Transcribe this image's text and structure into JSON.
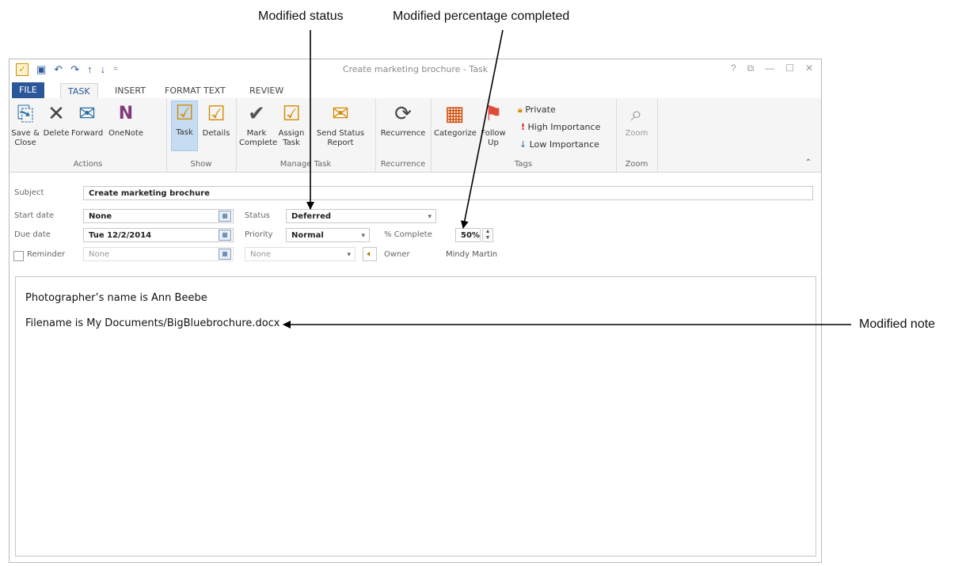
{
  "callouts": {
    "modified_status": "Modified status",
    "modified_percentage": "Modified percentage completed",
    "modified_note": "Modified note"
  },
  "window": {
    "title": "Create marketing brochure - Task",
    "help": "?",
    "restore_ribbon": "⧉",
    "minimize": "—",
    "maximize": "☐",
    "close": "✕"
  },
  "quick_access": {
    "app_icon": "task-app-icon",
    "save": "save-icon",
    "undo": "undo-icon",
    "redo": "redo-icon",
    "up": "arrow-up-icon",
    "down": "arrow-down-icon",
    "customize": "customize-icon"
  },
  "tabs": [
    "FILE",
    "TASK",
    "INSERT",
    "FORMAT TEXT",
    "REVIEW"
  ],
  "ribbon": {
    "groups": {
      "actions": "Actions",
      "show": "Show",
      "manage_task": "Manage Task",
      "recurrence": "Recurrence",
      "tags": "Tags",
      "zoom": "Zoom"
    },
    "buttons": {
      "save_close": "Save & Close",
      "delete": "Delete",
      "forward": "Forward",
      "onenote": "OneNote",
      "task": "Task",
      "details": "Details",
      "mark_complete": "Mark Complete",
      "assign_task": "Assign Task",
      "send_status": "Send Status Report",
      "recurrence": "Recurrence",
      "categorize": "Categorize",
      "follow_up": "Follow Up",
      "private": "Private",
      "high_importance": "High Importance",
      "low_importance": "Low Importance",
      "zoom": "Zoom"
    }
  },
  "form": {
    "subject_label": "Subject",
    "subject_value": "Create marketing brochure",
    "start_date_label": "Start date",
    "start_date_value": "None",
    "due_date_label": "Due date",
    "due_date_value": "Tue 12/2/2014",
    "reminder_label": "Reminder",
    "reminder_date": "None",
    "reminder_time": "None",
    "status_label": "Status",
    "status_value": "Deferred",
    "priority_label": "Priority",
    "priority_value": "Normal",
    "complete_label": "% Complete",
    "complete_value": "50%",
    "owner_label": "Owner",
    "owner_value": "Mindy Martin"
  },
  "notes": [
    "Photographer’s name is Ann Beebe",
    "Filename is My Documents/BigBluebrochure.docx"
  ],
  "colors": {
    "accent": "#2b579a",
    "selected": "#c5dcf2"
  }
}
